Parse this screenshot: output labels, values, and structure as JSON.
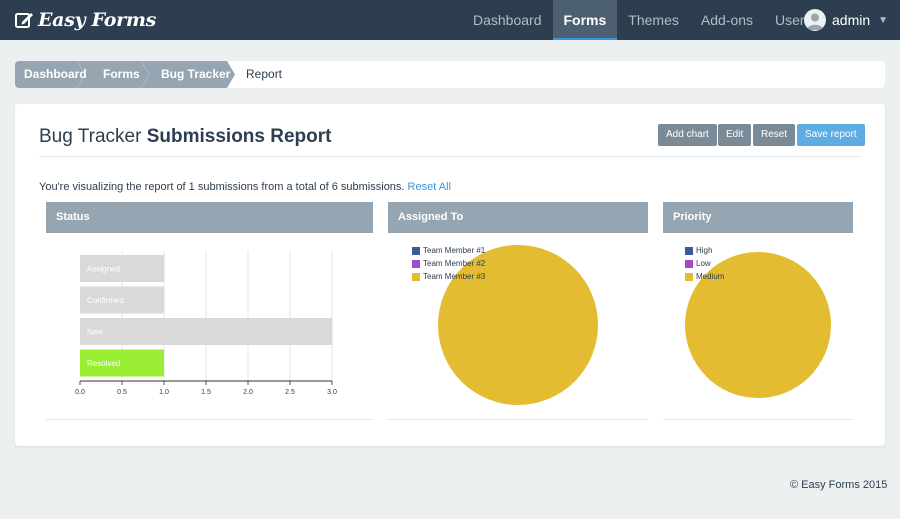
{
  "navbar": {
    "brand": "Easy Forms",
    "items": [
      {
        "label": "Dashboard",
        "active": false
      },
      {
        "label": "Forms",
        "active": true
      },
      {
        "label": "Themes",
        "active": false
      },
      {
        "label": "Add-ons",
        "active": false
      },
      {
        "label": "Users",
        "active": false
      }
    ],
    "user": "admin"
  },
  "breadcrumb": [
    "Dashboard",
    "Forms",
    "Bug Tracker",
    "Report"
  ],
  "page": {
    "title_prefix": "Bug Tracker",
    "title_bold": "Submissions Report",
    "info_text": "You're visualizing the report of 1 submissions from a total of 6 submissions.",
    "reset_all": "Reset All"
  },
  "buttons": {
    "add_chart": "Add chart",
    "edit": "Edit",
    "reset": "Reset",
    "save": "Save report"
  },
  "colors": {
    "navbar": "#2c3e50",
    "panel_header": "#95a5b1",
    "bar_default": "#d9d9d9",
    "bar_selected": "#99ee33",
    "pie": "#e3bc31",
    "legend_blue": "#3c5a9a",
    "legend_purple": "#a24bc7",
    "legend_gold": "#e3bc31"
  },
  "chart_data": [
    {
      "type": "bar",
      "orientation": "horizontal",
      "title": "Status",
      "categories": [
        "Assigned",
        "Confirmed",
        "New",
        "Resolved"
      ],
      "values": [
        1,
        1,
        3,
        1
      ],
      "selected": "Resolved",
      "xlim": [
        0,
        3
      ],
      "xticks": [
        "0.0",
        "0.5",
        "1.0",
        "1.5",
        "2.0",
        "2.5",
        "3.0"
      ],
      "grid": true
    },
    {
      "type": "pie",
      "title": "Assigned To",
      "legend": [
        "Team Member #1",
        "Team Member #2",
        "Team Member #3"
      ],
      "values": [
        0,
        0,
        1
      ],
      "legend_position": "top-left"
    },
    {
      "type": "pie",
      "title": "Priority",
      "legend": [
        "High",
        "Low",
        "Medium"
      ],
      "values": [
        0,
        0,
        1
      ],
      "legend_position": "top-left"
    }
  ],
  "footer": "© Easy Forms 2015"
}
